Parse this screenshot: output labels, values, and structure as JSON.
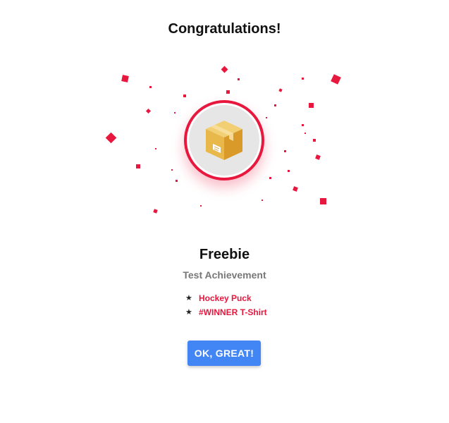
{
  "dialog": {
    "title": "Congratulations!",
    "achievement_name": "Freebie",
    "achievement_subtitle": "Test Achievement",
    "rewards": [
      {
        "label": "Hockey Puck"
      },
      {
        "label": "#WINNER T-Shirt"
      }
    ],
    "ok_button_label": "OK, GREAT!"
  },
  "icons": {
    "badge": "package-box-icon",
    "reward_bullet": "star-icon",
    "confetti": "confetti-piece"
  },
  "colors": {
    "accent": "#e8173e",
    "button": "#4285f4",
    "box": "#e8b94a",
    "badge_background": "#e6e6e6"
  }
}
